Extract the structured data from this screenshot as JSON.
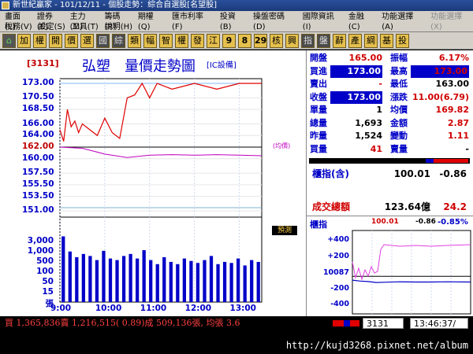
{
  "window": {
    "title": "新世紀贏家 - 101/12/11 - 個股走勢：綜合自選股[名望股]"
  },
  "menu": {
    "row1": [
      "畫面(L)",
      "證券(E)",
      "主力(M)",
      "籌碼(R)",
      "期權(Q)",
      "匯市利率(F)",
      "投資(B)",
      "操盤密碼(D)",
      "國際資訊(I)",
      "金融(C)",
      "功能選擇(A)",
      "功能選擇(X)"
    ],
    "row2": [
      "稅務(V)",
      "設定(S)",
      "工具(T)",
      "說明(H)"
    ]
  },
  "toolbar": {
    "buttons": [
      "加",
      "權",
      "開",
      "價",
      "選",
      "國",
      "綜",
      "類",
      "幅",
      "智",
      "權",
      "發",
      "江",
      "9",
      "8",
      "29",
      "核",
      "興",
      "指",
      "盤",
      "辭",
      "產",
      "綱",
      "基",
      "投"
    ]
  },
  "stock": {
    "code": "[3131]",
    "title": "弘塑　量價走勢圖",
    "tag": "[IC設備]"
  },
  "price_axis": [
    "173.00",
    "170.50",
    "168.50",
    "166.00",
    "164.00",
    "162.00",
    "160.00",
    "157.50",
    "155.50",
    "153.50",
    "151.00"
  ],
  "volume_axis": [
    "3,000",
    "1,000",
    "500",
    "100",
    "50",
    "15",
    "張"
  ],
  "time_axis": [
    "9:00",
    "10:00",
    "11:00",
    "12:00",
    "13:00"
  ],
  "chart_labels": {
    "avg_note": "(均價)",
    "predict": "預測"
  },
  "quote": {
    "rows": [
      {
        "l1": "開盤",
        "v1": "165.00",
        "l2": "振幅",
        "v2": "6.17%"
      },
      {
        "l1": "買進",
        "v1": "173.00",
        "l2": "最高",
        "v2": "173.00"
      },
      {
        "l1": "賣出",
        "v1": "-",
        "l2": "最低",
        "v2": "163.00"
      },
      {
        "l1": "收盤",
        "v1": "173.00",
        "l2": "漲跌",
        "v2": "11.00(6.79)"
      },
      {
        "l1": "單量",
        "v1": "1",
        "l2": "均價",
        "v2": "169.82"
      },
      {
        "l1": "總量",
        "v1": "1,693",
        "l2": "金額",
        "v2": "2.87"
      },
      {
        "l1": "昨量",
        "v1": "1,524",
        "l2": "變動",
        "v2": "1.11"
      },
      {
        "l1": "買量",
        "v1": "41",
        "l2": "賣量",
        "v2": "-"
      }
    ]
  },
  "index": {
    "label": "櫃指(含)",
    "value": "100.01",
    "change": "-0.86",
    "turnover_label": "成交總額",
    "turnover_value": "123.64億",
    "turnover_change": "24.2"
  },
  "mini_chart": {
    "title": "櫃指",
    "value": "100.01",
    "change": "-0.86",
    "pct": "-0.85%",
    "axis": [
      "+400",
      "+200",
      "10087",
      "-200",
      "-400"
    ]
  },
  "status": {
    "text": "買 1,365,836賣 1,216,515( 0.89)成 509,136張, 均張 3.6",
    "code": "3131",
    "time": "13:46:37/"
  },
  "footer": {
    "url": "http://kujd3268.pixnet.net/album"
  },
  "chart_data": {
    "type": "line",
    "x_range": [
      "9:00",
      "13:30"
    ],
    "ylim": [
      151.0,
      173.0
    ],
    "reference_price": 162.0,
    "series": [
      {
        "x": [
          "9:00",
          "9:05",
          "9:10",
          "9:15",
          "9:20",
          "9:25",
          "9:30",
          "9:40",
          "9:50",
          "10:00",
          "10:10",
          "10:20",
          "10:30",
          "10:40",
          "10:50",
          "11:00",
          "11:10",
          "11:30",
          "12:00",
          "12:30",
          "13:00",
          "13:30"
        ],
        "y": [
          165.0,
          163.0,
          168.5,
          165.5,
          166.5,
          164.5,
          166.0,
          165.0,
          164.0,
          167.0,
          164.5,
          163.5,
          170.5,
          171.0,
          173.0,
          170.5,
          173.0,
          172.0,
          173.0,
          172.0,
          173.0,
          173.0
        ]
      },
      {
        "x": [
          "9:00",
          "9:30",
          "10:00",
          "10:30",
          "11:00",
          "11:30",
          "12:00",
          "12:30",
          "13:00",
          "13:30"
        ],
        "y": [
          162.0,
          161.8,
          160.8,
          160.2,
          160.6,
          160.7,
          160.6,
          160.7,
          160.6,
          160.5
        ]
      }
    ],
    "volume": {
      "ylim": [
        0,
        3000
      ],
      "values": [
        620,
        140,
        80,
        110,
        90,
        60,
        150,
        70,
        60,
        90,
        110,
        70,
        160,
        60,
        40,
        80,
        50,
        40,
        70,
        55,
        45,
        60,
        90,
        40,
        50,
        45,
        70,
        35,
        60,
        50
      ]
    }
  }
}
